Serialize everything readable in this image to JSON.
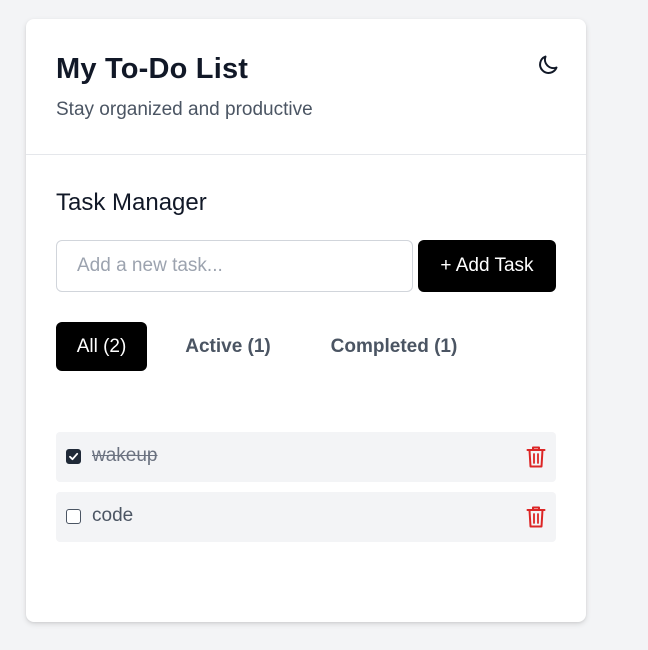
{
  "header": {
    "title": "My To-Do List",
    "subtitle": "Stay organized and productive",
    "theme_icon": "moon-icon"
  },
  "manager": {
    "title": "Task Manager",
    "input_placeholder": "Add a new task...",
    "input_value": "",
    "add_label": "+ Add Task"
  },
  "filters": [
    {
      "label": "All (2)",
      "active": true
    },
    {
      "label": "Active (1)",
      "active": false
    },
    {
      "label": "Completed (1)",
      "active": false
    }
  ],
  "tasks": [
    {
      "text": "wakeup",
      "completed": true
    },
    {
      "text": "code",
      "completed": false
    }
  ],
  "colors": {
    "accent": "#000000",
    "delete": "#dc2626",
    "background": "#f3f4f6"
  },
  "icons": {
    "delete": "trash-icon",
    "checkbox": "checkbox-icon"
  }
}
